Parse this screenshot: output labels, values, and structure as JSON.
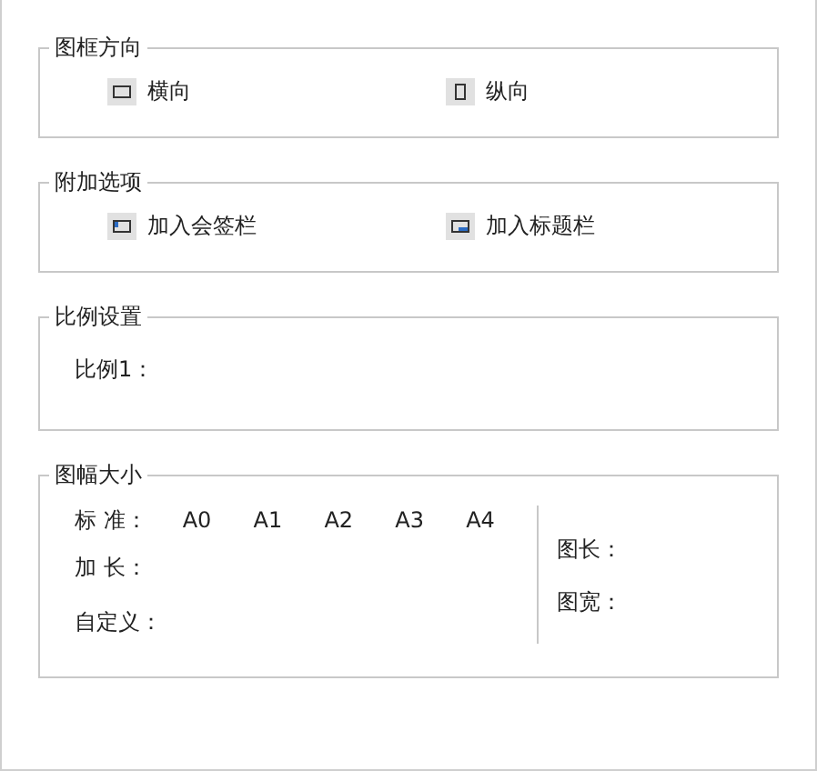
{
  "orientation": {
    "title": "图框方向",
    "options": [
      {
        "label": "横向",
        "kind": "landscape"
      },
      {
        "label": "纵向",
        "kind": "portrait"
      }
    ]
  },
  "extras": {
    "title": "附加选项",
    "options": [
      {
        "label": "加入会签栏",
        "kind": "countersign"
      },
      {
        "label": "加入标题栏",
        "kind": "titleblock"
      }
    ]
  },
  "scale": {
    "title": "比例设置",
    "label": "比例1："
  },
  "size": {
    "title": "图幅大小",
    "standard_label": "标 准：",
    "standard_options": [
      "A0",
      "A1",
      "A2",
      "A3",
      "A4"
    ],
    "lengthen_label": "加 长：",
    "custom_label": "自定义：",
    "length_label": "图长：",
    "width_label": "图宽："
  }
}
